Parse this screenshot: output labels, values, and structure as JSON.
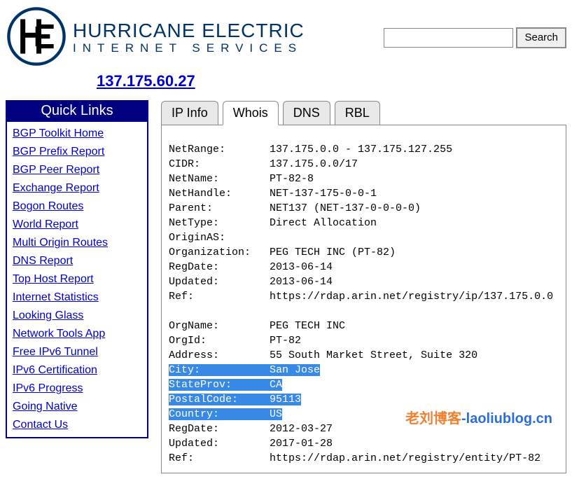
{
  "brand": {
    "title": "HURRICANE ELECTRIC",
    "subtitle": "INTERNET SERVICES"
  },
  "search": {
    "placeholder": "",
    "button": "Search",
    "value": ""
  },
  "ip_heading": "137.175.60.27",
  "sidebar": {
    "title": "Quick Links",
    "links": [
      "BGP Toolkit Home",
      "BGP Prefix Report",
      "BGP Peer Report",
      "Exchange Report",
      "Bogon Routes",
      "World Report",
      "Multi Origin Routes",
      "DNS Report",
      "Top Host Report",
      "Internet Statistics",
      "Looking Glass",
      "Network Tools App",
      "Free IPv6 Tunnel",
      "IPv6 Certification",
      "IPv6 Progress",
      "Going Native",
      "Contact Us"
    ]
  },
  "tabs": [
    "IP Info",
    "Whois",
    "DNS",
    "RBL"
  ],
  "active_tab": "Whois",
  "whois": {
    "block1": [
      [
        "NetRange:",
        "137.175.0.0 - 137.175.127.255"
      ],
      [
        "CIDR:",
        "137.175.0.0/17"
      ],
      [
        "NetName:",
        "PT-82-8"
      ],
      [
        "NetHandle:",
        "NET-137-175-0-0-1"
      ],
      [
        "Parent:",
        "NET137 (NET-137-0-0-0-0)"
      ],
      [
        "NetType:",
        "Direct Allocation"
      ],
      [
        "OriginAS:",
        ""
      ],
      [
        "Organization:",
        "PEG TECH INC (PT-82)"
      ],
      [
        "RegDate:",
        "2013-06-14"
      ],
      [
        "Updated:",
        "2013-06-14"
      ],
      [
        "Ref:",
        "https://rdap.arin.net/registry/ip/137.175.0.0"
      ]
    ],
    "block2_pre": [
      [
        "OrgName:",
        "PEG TECH INC"
      ],
      [
        "OrgId:",
        "PT-82"
      ],
      [
        "Address:",
        "55 South Market Street, Suite 320"
      ]
    ],
    "block2_sel": [
      [
        "City:",
        "San Jose"
      ],
      [
        "StateProv:",
        "CA"
      ],
      [
        "PostalCode:",
        "95113"
      ],
      [
        "Country:",
        "US"
      ]
    ],
    "block2_post": [
      [
        "RegDate:",
        "2012-03-27"
      ],
      [
        "Updated:",
        "2017-01-28"
      ],
      [
        "Ref:",
        "https://rdap.arin.net/registry/entity/PT-82"
      ]
    ]
  },
  "watermark": {
    "a": "老刘博客",
    "b": "-laoliublog.cn"
  }
}
